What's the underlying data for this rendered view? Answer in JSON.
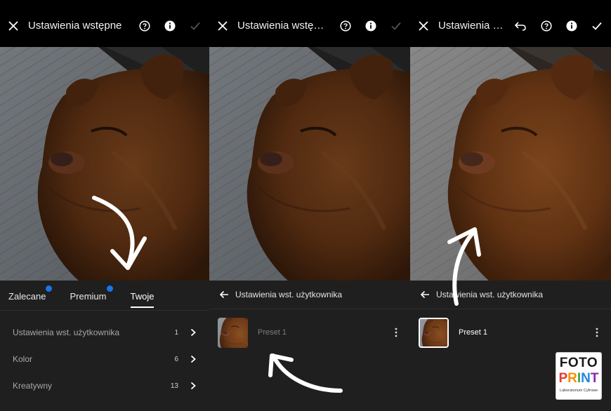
{
  "panels": {
    "p1": {
      "title": "Ustawienia wstępne"
    },
    "p2": {
      "title": "Ustawienia wstępne"
    },
    "p3": {
      "title": "Ustawienia wst..."
    }
  },
  "tabs": [
    {
      "label": "Zalecane",
      "badge": true
    },
    {
      "label": "Premium",
      "badge": true
    },
    {
      "label": "Twoje",
      "active": true
    }
  ],
  "categories": [
    {
      "label": "Ustawienia wst. użytkownika",
      "count": "1"
    },
    {
      "label": "Kolor",
      "count": "6"
    },
    {
      "label": "Kreatywny",
      "count": "13"
    }
  ],
  "sub_header": "Ustawienia wst. użytkownika",
  "preset": {
    "name": "Preset 1"
  },
  "icons": {
    "close": "close-icon",
    "help": "help-icon",
    "info": "info-icon",
    "check": "check-icon",
    "undo": "undo-icon",
    "back": "back-arrow-icon",
    "chevron": "chevron-right-icon",
    "more": "more-vertical-icon"
  },
  "colors": {
    "accent": "#1b73e8",
    "sheet": "#1f1f1f",
    "topbar": "#000000"
  },
  "logo": {
    "line1": "FOTO",
    "line2": "PRINT",
    "line3": "Laboratorium Cyfrowe"
  }
}
